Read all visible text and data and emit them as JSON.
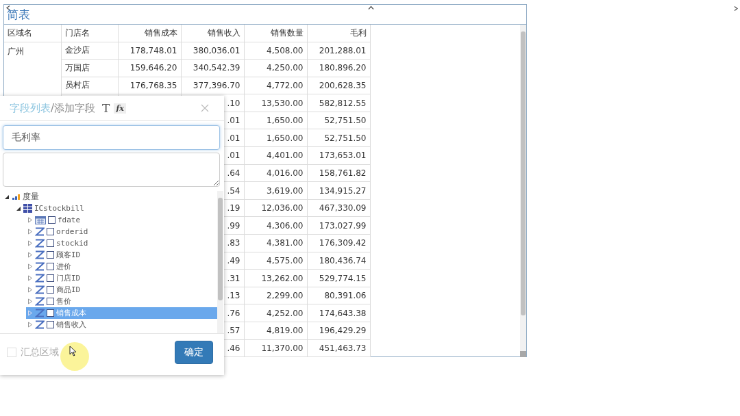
{
  "panel": {
    "title": "简表"
  },
  "table": {
    "columns": [
      {
        "label": "区域名"
      },
      {
        "label": "门店名"
      },
      {
        "label": "销售成本"
      },
      {
        "label": "销售收入"
      },
      {
        "label": "销售数量"
      },
      {
        "label": "毛利"
      }
    ],
    "rows": [
      {
        "cells": [
          "广州",
          "金沙店",
          "178,748.01",
          "380,036.01",
          "4,508.00",
          "201,288.01"
        ]
      },
      {
        "cells": [
          "万国店",
          "159,646.20",
          "340,542.39",
          "4,250.00",
          "180,896.20"
        ]
      },
      {
        "cells": [
          "员村店",
          "176,768.35",
          "377,396.70",
          "4,772.00",
          "200,628.35"
        ]
      },
      {
        "cells": [
          ".10",
          "13,530.00",
          "582,812.55"
        ]
      },
      {
        "cells": [
          ".01",
          "1,650.00",
          "52,751.50"
        ]
      },
      {
        "cells": [
          ".01",
          "1,650.00",
          "52,751.50"
        ]
      },
      {
        "cells": [
          ".01",
          "4,401.00",
          "173,653.01"
        ]
      },
      {
        "cells": [
          ".64",
          "4,016.00",
          "158,761.82"
        ]
      },
      {
        "cells": [
          ".54",
          "3,619.00",
          "134,915.27"
        ]
      },
      {
        "cells": [
          ".19",
          "12,036.00",
          "467,330.09"
        ]
      },
      {
        "cells": [
          ".99",
          "4,306.00",
          "173,027.99"
        ]
      },
      {
        "cells": [
          ".83",
          "4,381.00",
          "176,309.42"
        ]
      },
      {
        "cells": [
          ".49",
          "4,575.00",
          "180,436.74"
        ]
      },
      {
        "cells": [
          ".31",
          "13,262.00",
          "529,774.15"
        ]
      },
      {
        "cells": [
          ".13",
          "2,299.00",
          "80,391.06"
        ]
      },
      {
        "cells": [
          ".76",
          "4,252.00",
          "174,643.38"
        ]
      },
      {
        "cells": [
          ".57",
          "4,819.00",
          "196,429.29"
        ]
      },
      {
        "cells": [
          ".46",
          "11,370.00",
          "451,463.73"
        ]
      }
    ]
  },
  "dialog": {
    "title_active": "字段列表",
    "title_rest": "/添加字段",
    "text_tool": "T",
    "formula_tool": "fx",
    "name_field": {
      "value": "毛利率"
    },
    "tree": [
      {
        "label": "度量",
        "kind": "measure",
        "expanded": true,
        "selected": false,
        "children": [
          {
            "label": "ICstockbill",
            "kind": "table",
            "expanded": true,
            "selected": false,
            "children": [
              {
                "label": "fdate",
                "kind": "date",
                "expanded": false,
                "checked": false,
                "selected": false
              },
              {
                "label": "orderid",
                "kind": "number",
                "expanded": false,
                "checked": false,
                "selected": false
              },
              {
                "label": "stockid",
                "kind": "number",
                "expanded": false,
                "checked": false,
                "selected": false
              },
              {
                "label": "顾客ID",
                "kind": "number",
                "expanded": false,
                "checked": false,
                "selected": false
              },
              {
                "label": "进价",
                "kind": "number",
                "expanded": false,
                "checked": false,
                "selected": false
              },
              {
                "label": "门店ID",
                "kind": "number",
                "expanded": false,
                "checked": false,
                "selected": false
              },
              {
                "label": "商品ID",
                "kind": "number",
                "expanded": false,
                "checked": false,
                "selected": false
              },
              {
                "label": "售价",
                "kind": "number",
                "expanded": false,
                "checked": false,
                "selected": false
              },
              {
                "label": "销售成本",
                "kind": "number",
                "expanded": false,
                "checked": false,
                "selected": true
              },
              {
                "label": "销售收入",
                "kind": "number",
                "expanded": false,
                "checked": false,
                "selected": false
              }
            ]
          }
        ]
      }
    ],
    "summary": {
      "label": "汇总区域",
      "checked": false
    },
    "confirm": "确定"
  }
}
